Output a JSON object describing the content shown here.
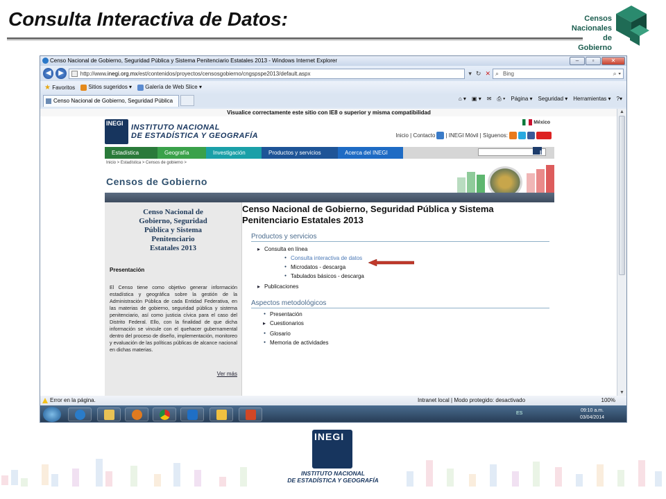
{
  "slide": {
    "title": "Consulta Interactiva de Datos:",
    "logo_lines": [
      "Censos",
      "Nacionales",
      "de Gobierno"
    ]
  },
  "browser": {
    "window_title": "Censo Nacional de Gobierno, Seguridad Pública y Sistema Penitenciario Estatales 2013 - Windows Internet Explorer",
    "url_prefix": "http://www.",
    "url_host": "inegi.org.mx",
    "url_path": "/est/contenidos/proyectos/censosgobierno/cngspspe2013/default.aspx",
    "search_placeholder": "Bing",
    "favorites_label": "Favoritos",
    "suggested_sites": "Sitios sugeridos ▾",
    "web_slice": "Galería de Web Slice ▾",
    "tab_title": "Censo Nacional de Gobierno, Seguridad Pública ...",
    "cmd_items": [
      "Página ▾",
      "Seguridad ▾",
      "Herramientas ▾"
    ],
    "status_error": "Error en la página.",
    "status_zone": "Intranet local | Modo protegido: desactivado",
    "status_zoom": "100%",
    "tray_lang": "ES",
    "tray_time": "09:10 a.m.",
    "tray_date": "03/04/2014"
  },
  "site": {
    "ie8_notice": "Visualice correctamente este sitio con IE8 o superior y misma compatibilidad",
    "inegi_line1": "INSTITUTO NACIONAL",
    "inegi_line2": "DE ESTADÍSTICA Y GEOGRAFÍA",
    "country": "México",
    "top_links": "Inicio | Contacto",
    "top_links2": "| INEGI Móvil | Síguenos:",
    "nav": [
      {
        "label": "Estadística",
        "color": "#2a7a3a"
      },
      {
        "label": "Geografía",
        "color": "#3aa14a"
      },
      {
        "label": "Investigación",
        "color": "#1aa0a8"
      },
      {
        "label": "Productos y servicios",
        "color": "#1e5497"
      },
      {
        "label": "Acerca del INEGI",
        "color": "#1e6bc4"
      }
    ],
    "search_go": "IR",
    "breadcrumb": "Inicio > Estadística > Censos de gobierno >",
    "banner_title": "Censos de Gobierno",
    "sidebar": {
      "census_name_lines": [
        "Censo Nacional de",
        "Gobierno, Seguridad",
        "Pública y Sistema",
        "Penitenciario",
        "Estatales 2013"
      ],
      "presentation_title": "Presentación",
      "presentation_text": "El Censo tiene como objetivo generar información estadística y geográfica sobre la gestión de la Administración Pública de cada Entidad Federativa, en las materias de gobierno, seguridad pública y sistema penitenciario, así como justicia cívica para el caso del Distrito Federal. Ello, con la finalidad de que dicha información se vincule con el quehacer gubernamental dentro del proceso de diseño, implementación, monitoreo y evaluación de las políticas públicas de alcance nacional en dichas materias.",
      "more_link": "Ver más"
    },
    "main": {
      "heading": "Censo Nacional de Gobierno, Seguridad Pública y Sistema Penitenciario Estatales 2013",
      "products_title": "Productos y servicios",
      "online_query": "Consulta en línea",
      "online_items": [
        "Consulta interactiva de datos",
        "Microdatos - descarga",
        "Tabulados básicos - descarga"
      ],
      "publications": "Publicaciones",
      "methodology_title": "Aspectos metodológicos",
      "method_items": [
        {
          "label": "Presentación",
          "kind": "bullet"
        },
        {
          "label": "Cuestionarios",
          "kind": "arrow"
        },
        {
          "label": "Glosario",
          "kind": "bullet"
        },
        {
          "label": "Memoria de actividades",
          "kind": "bullet"
        }
      ]
    }
  },
  "footer_logo": {
    "abbrev": "INEGI",
    "line1": "INSTITUTO NACIONAL",
    "line2": "DE ESTADÍSTICA Y GEOGRAFÍA"
  }
}
